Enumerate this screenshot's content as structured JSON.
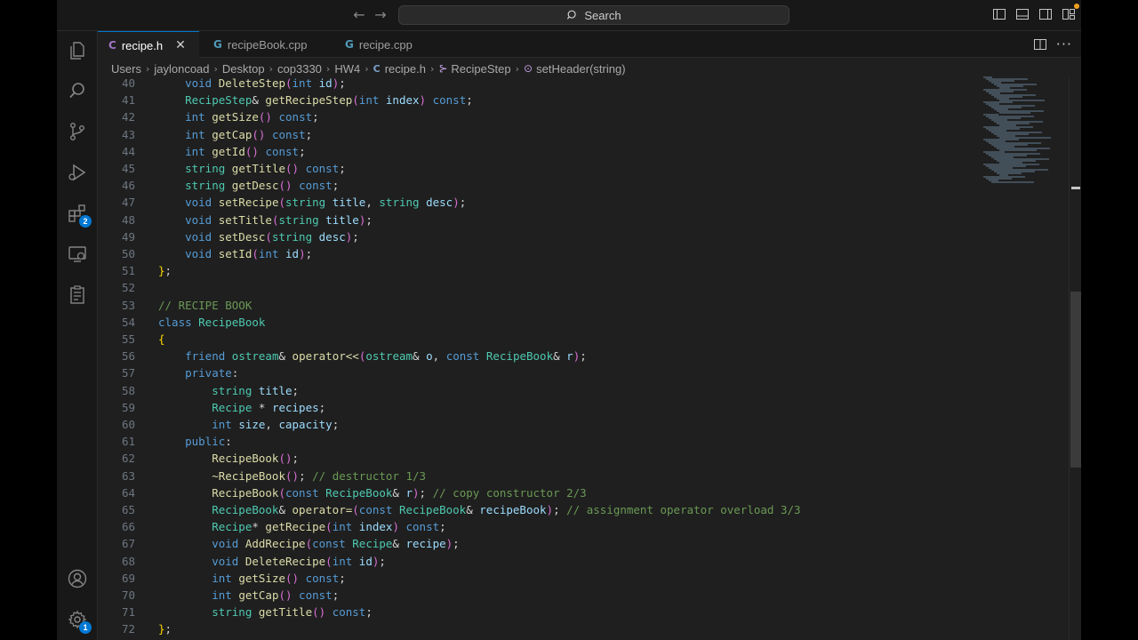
{
  "titlebar": {
    "search_placeholder": "Search",
    "back_glyph": "←",
    "forward_glyph": "→"
  },
  "activity_bar": {
    "items": [
      {
        "name": "explorer-icon"
      },
      {
        "name": "search-icon"
      },
      {
        "name": "source-control-icon"
      },
      {
        "name": "run-debug-icon"
      },
      {
        "name": "extensions-icon",
        "badge": "2"
      },
      {
        "name": "remote-explorer-icon"
      },
      {
        "name": "testing-icon"
      }
    ],
    "bottom": [
      {
        "name": "accounts-icon"
      },
      {
        "name": "settings-gear-icon",
        "badge": "1"
      }
    ]
  },
  "tabs": [
    {
      "label": "recipe.h",
      "icon": "C",
      "active": true,
      "close": "✕"
    },
    {
      "label": "recipeBook.cpp",
      "icon": "G",
      "active": false
    },
    {
      "label": "recipe.cpp",
      "icon": "G",
      "active": false
    }
  ],
  "breadcrumb": [
    "Users",
    "jayloncoad",
    "Desktop",
    "cop3330",
    "HW4",
    "recipe.h",
    "RecipeStep",
    "setHeader(string)"
  ],
  "editor": {
    "first_line": 40,
    "lines": [
      [
        [
          "kw",
          "    void "
        ],
        [
          "fn",
          "DeleteStep"
        ],
        [
          "br2",
          "("
        ],
        [
          "kw",
          "int "
        ],
        [
          "pm",
          "id"
        ],
        [
          "br2",
          ")"
        ],
        [
          "pu",
          ";"
        ]
      ],
      [
        [
          "ty",
          "    RecipeStep"
        ],
        [
          "pu",
          "& "
        ],
        [
          "fn",
          "getRecipeStep"
        ],
        [
          "br2",
          "("
        ],
        [
          "kw",
          "int "
        ],
        [
          "pm",
          "index"
        ],
        [
          "br2",
          ")"
        ],
        [
          "kw",
          " const"
        ],
        [
          "pu",
          ";"
        ]
      ],
      [
        [
          "kw",
          "    int "
        ],
        [
          "fn",
          "getSize"
        ],
        [
          "br2",
          "()"
        ],
        [
          "kw",
          " const"
        ],
        [
          "pu",
          ";"
        ]
      ],
      [
        [
          "kw",
          "    int "
        ],
        [
          "fn",
          "getCap"
        ],
        [
          "br2",
          "()"
        ],
        [
          "kw",
          " const"
        ],
        [
          "pu",
          ";"
        ]
      ],
      [
        [
          "kw",
          "    int "
        ],
        [
          "fn",
          "getId"
        ],
        [
          "br2",
          "()"
        ],
        [
          "kw",
          " const"
        ],
        [
          "pu",
          ";"
        ]
      ],
      [
        [
          "ty",
          "    string "
        ],
        [
          "fn",
          "getTitle"
        ],
        [
          "br2",
          "()"
        ],
        [
          "kw",
          " const"
        ],
        [
          "pu",
          ";"
        ]
      ],
      [
        [
          "ty",
          "    string "
        ],
        [
          "fn",
          "getDesc"
        ],
        [
          "br2",
          "()"
        ],
        [
          "kw",
          " const"
        ],
        [
          "pu",
          ";"
        ]
      ],
      [
        [
          "kw",
          "    void "
        ],
        [
          "fn",
          "setRecipe"
        ],
        [
          "br2",
          "("
        ],
        [
          "ty",
          "string "
        ],
        [
          "pm",
          "title"
        ],
        [
          "pu",
          ", "
        ],
        [
          "ty",
          "string "
        ],
        [
          "pm",
          "desc"
        ],
        [
          "br2",
          ")"
        ],
        [
          "pu",
          ";"
        ]
      ],
      [
        [
          "kw",
          "    void "
        ],
        [
          "fn",
          "setTitle"
        ],
        [
          "br2",
          "("
        ],
        [
          "ty",
          "string "
        ],
        [
          "pm",
          "title"
        ],
        [
          "br2",
          ")"
        ],
        [
          "pu",
          ";"
        ]
      ],
      [
        [
          "kw",
          "    void "
        ],
        [
          "fn",
          "setDesc"
        ],
        [
          "br2",
          "("
        ],
        [
          "ty",
          "string "
        ],
        [
          "pm",
          "desc"
        ],
        [
          "br2",
          ")"
        ],
        [
          "pu",
          ";"
        ]
      ],
      [
        [
          "kw",
          "    void "
        ],
        [
          "fn",
          "setId"
        ],
        [
          "br2",
          "("
        ],
        [
          "kw",
          "int "
        ],
        [
          "pm",
          "id"
        ],
        [
          "br2",
          ")"
        ],
        [
          "pu",
          ";"
        ]
      ],
      [
        [
          "br",
          "}"
        ],
        [
          "pu",
          ";"
        ]
      ],
      [],
      [
        [
          "cm",
          "// RECIPE BOOK"
        ]
      ],
      [
        [
          "kw",
          "class "
        ],
        [
          "ty",
          "RecipeBook"
        ]
      ],
      [
        [
          "br",
          "{"
        ]
      ],
      [
        [
          "kw",
          "    friend "
        ],
        [
          "ty",
          "ostream"
        ],
        [
          "pu",
          "& "
        ],
        [
          "fn",
          "operator<<"
        ],
        [
          "br2",
          "("
        ],
        [
          "ty",
          "ostream"
        ],
        [
          "pu",
          "& "
        ],
        [
          "pm",
          "o"
        ],
        [
          "pu",
          ", "
        ],
        [
          "kw",
          "const "
        ],
        [
          "ty",
          "RecipeBook"
        ],
        [
          "pu",
          "& "
        ],
        [
          "pm",
          "r"
        ],
        [
          "br2",
          ")"
        ],
        [
          "pu",
          ";"
        ]
      ],
      [
        [
          "kw",
          "    private"
        ],
        [
          "pu",
          ":"
        ]
      ],
      [
        [
          "ty",
          "        string "
        ],
        [
          "pm",
          "title"
        ],
        [
          "pu",
          ";"
        ]
      ],
      [
        [
          "ty",
          "        Recipe "
        ],
        [
          "pu",
          "* "
        ],
        [
          "pm",
          "recipes"
        ],
        [
          "pu",
          ";"
        ]
      ],
      [
        [
          "kw",
          "        int "
        ],
        [
          "pm",
          "size"
        ],
        [
          "pu",
          ", "
        ],
        [
          "pm",
          "capacity"
        ],
        [
          "pu",
          ";"
        ]
      ],
      [
        [
          "kw",
          "    public"
        ],
        [
          "pu",
          ":"
        ]
      ],
      [
        [
          "fn",
          "        RecipeBook"
        ],
        [
          "br2",
          "()"
        ],
        [
          "pu",
          ";"
        ]
      ],
      [
        [
          "fn",
          "        ~RecipeBook"
        ],
        [
          "br2",
          "()"
        ],
        [
          "pu",
          "; "
        ],
        [
          "cm",
          "// destructor 1/3"
        ]
      ],
      [
        [
          "fn",
          "        RecipeBook"
        ],
        [
          "br2",
          "("
        ],
        [
          "kw",
          "const "
        ],
        [
          "ty",
          "RecipeBook"
        ],
        [
          "pu",
          "& "
        ],
        [
          "pm",
          "r"
        ],
        [
          "br2",
          ")"
        ],
        [
          "pu",
          "; "
        ],
        [
          "cm",
          "// copy constructor 2/3"
        ]
      ],
      [
        [
          "ty",
          "        RecipeBook"
        ],
        [
          "pu",
          "& "
        ],
        [
          "fn",
          "operator="
        ],
        [
          "br2",
          "("
        ],
        [
          "kw",
          "const "
        ],
        [
          "ty",
          "RecipeBook"
        ],
        [
          "pu",
          "& "
        ],
        [
          "pm",
          "recipeBook"
        ],
        [
          "br2",
          ")"
        ],
        [
          "pu",
          "; "
        ],
        [
          "cm",
          "// assignment operator overload 3/3"
        ]
      ],
      [
        [
          "ty",
          "        Recipe"
        ],
        [
          "pu",
          "* "
        ],
        [
          "fn",
          "getRecipe"
        ],
        [
          "br2",
          "("
        ],
        [
          "kw",
          "int "
        ],
        [
          "pm",
          "index"
        ],
        [
          "br2",
          ")"
        ],
        [
          "kw",
          " const"
        ],
        [
          "pu",
          ";"
        ]
      ],
      [
        [
          "kw",
          "        void "
        ],
        [
          "fn",
          "AddRecipe"
        ],
        [
          "br2",
          "("
        ],
        [
          "kw",
          "const "
        ],
        [
          "ty",
          "Recipe"
        ],
        [
          "pu",
          "& "
        ],
        [
          "pm",
          "recipe"
        ],
        [
          "br2",
          ")"
        ],
        [
          "pu",
          ";"
        ]
      ],
      [
        [
          "kw",
          "        void "
        ],
        [
          "fn",
          "DeleteRecipe"
        ],
        [
          "br2",
          "("
        ],
        [
          "kw",
          "int "
        ],
        [
          "pm",
          "id"
        ],
        [
          "br2",
          ")"
        ],
        [
          "pu",
          ";"
        ]
      ],
      [
        [
          "kw",
          "        int "
        ],
        [
          "fn",
          "getSize"
        ],
        [
          "br2",
          "()"
        ],
        [
          "kw",
          " const"
        ],
        [
          "pu",
          ";"
        ]
      ],
      [
        [
          "kw",
          "        int "
        ],
        [
          "fn",
          "getCap"
        ],
        [
          "br2",
          "()"
        ],
        [
          "kw",
          " const"
        ],
        [
          "pu",
          ";"
        ]
      ],
      [
        [
          "ty",
          "        string "
        ],
        [
          "fn",
          "getTitle"
        ],
        [
          "br2",
          "()"
        ],
        [
          "kw",
          " const"
        ],
        [
          "pu",
          ";"
        ]
      ],
      [
        [
          "br",
          "}"
        ],
        [
          "pu",
          ";"
        ]
      ]
    ]
  }
}
